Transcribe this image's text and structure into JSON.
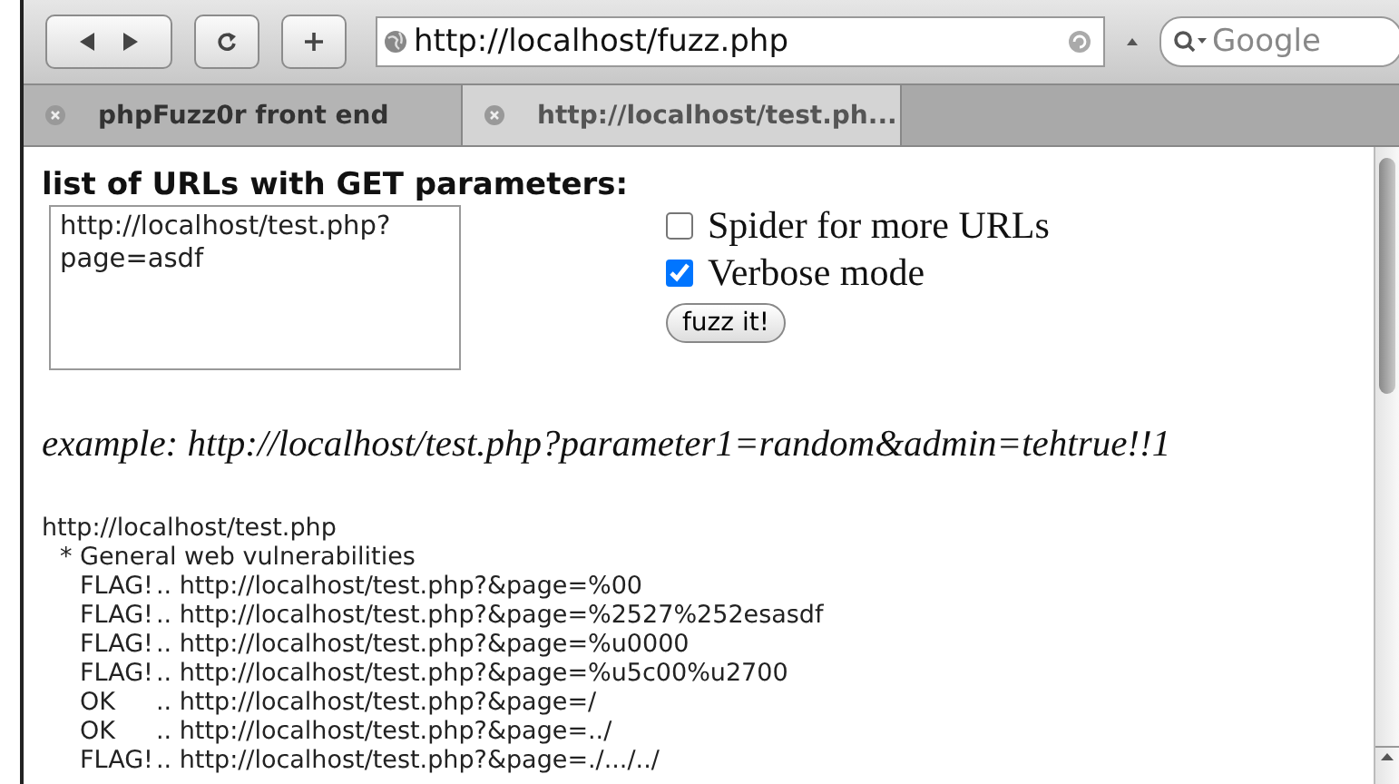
{
  "toolbar": {
    "address": "http://localhost/fuzz.php",
    "search": {
      "placeholder": "Google"
    }
  },
  "tabs": [
    {
      "label": "phpFuzz0r front end",
      "selected": true
    },
    {
      "label": "http://localhost/test.ph...",
      "selected": false
    }
  ],
  "form": {
    "heading": "list of URLs with GET parameters:",
    "urls_value": "http://localhost/test.php?\npage=asdf",
    "options": [
      {
        "label": "Spider for more URLs",
        "checked": false
      },
      {
        "label": "Verbose mode",
        "checked": true
      }
    ],
    "submit": "fuzz it!"
  },
  "example": "example: http://localhost/test.php?parameter1=random&admin=tehtrue!!1",
  "log": {
    "url": "http://localhost/test.php",
    "children": [
      {
        "text": "* General web vulnerabilities",
        "children": [
          {
            "status": "FLAG!",
            "text": ".. http://localhost/test.php?&page=%00"
          },
          {
            "status": "FLAG!",
            "text": ".. http://localhost/test.php?&page=%2527%252esasdf"
          },
          {
            "status": "FLAG!",
            "text": ".. http://localhost/test.php?&page=%u0000"
          },
          {
            "status": "FLAG!",
            "text": ".. http://localhost/test.php?&page=%u5c00%u2700"
          },
          {
            "status": "OK",
            "text": ".. http://localhost/test.php?&page=/"
          },
          {
            "status": "OK",
            "text": ".. http://localhost/test.php?&page=../"
          },
          {
            "status": "FLAG!",
            "text": ".. http://localhost/test.php?&page=./.../../"
          }
        ]
      }
    ]
  }
}
